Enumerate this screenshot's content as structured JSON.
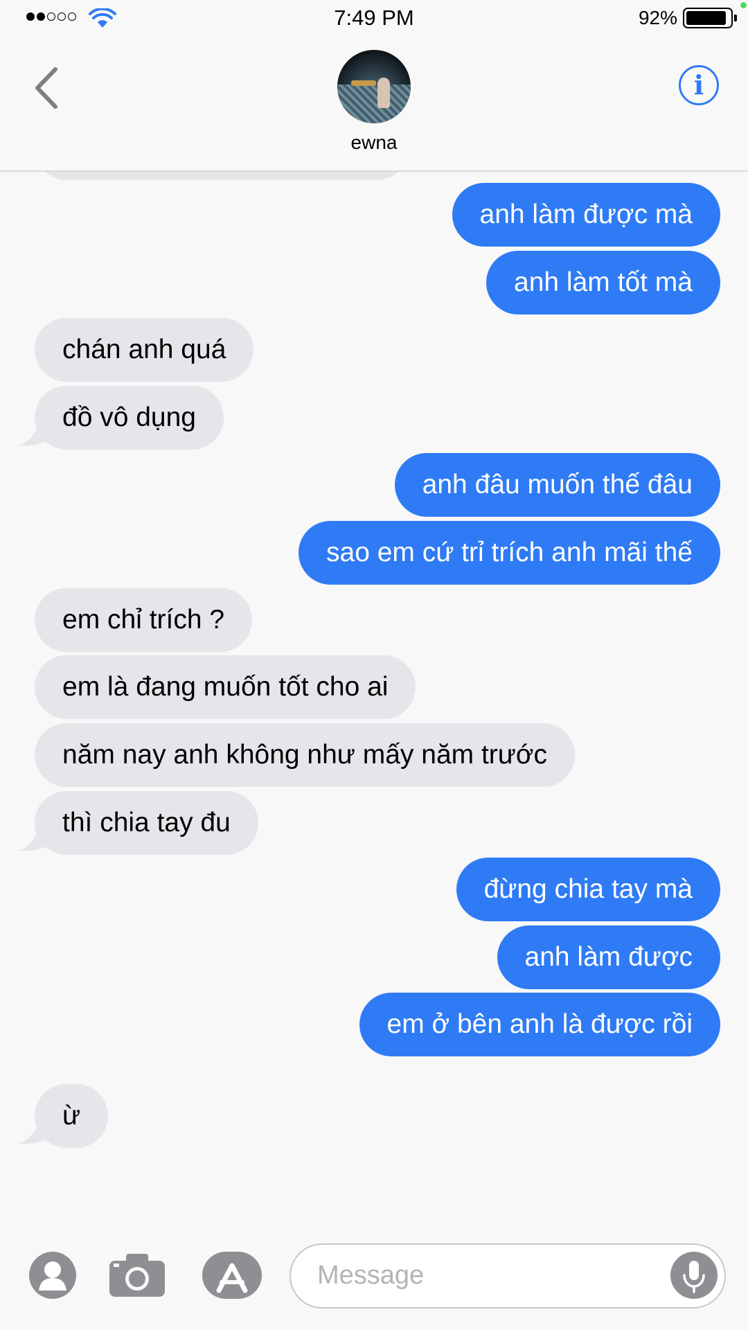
{
  "status_bar": {
    "time": "7:49 PM",
    "battery_percent": "92%",
    "signal_bars_filled": 2,
    "signal_bars_total": 5
  },
  "header": {
    "contact_name": "ewna",
    "back_icon": "chevron-left-icon",
    "info_icon": "info-icon"
  },
  "messages": [
    {
      "from": "me",
      "text": "anh làm được mà"
    },
    {
      "from": "me",
      "text": "anh làm tốt mà"
    },
    {
      "from": "them",
      "text": "chán anh quá"
    },
    {
      "from": "them",
      "text": "đồ vô dụng"
    },
    {
      "from": "me",
      "text": "anh đâu muốn thế đâu"
    },
    {
      "from": "me",
      "text": "sao em cứ trỉ trích anh mãi thế"
    },
    {
      "from": "them",
      "text": "em chỉ trích ?"
    },
    {
      "from": "them",
      "text": "em là đang muốn tốt cho ai"
    },
    {
      "from": "them",
      "text": "năm nay anh không như mấy năm trước"
    },
    {
      "from": "them",
      "text": "thì chia tay đu"
    },
    {
      "from": "me",
      "text": "đừng chia tay mà"
    },
    {
      "from": "me",
      "text": "anh làm được"
    },
    {
      "from": "me",
      "text": "em ở bên anh là được rồi"
    },
    {
      "from": "them",
      "text": "ừ"
    }
  ],
  "input": {
    "placeholder": "Message",
    "value": ""
  },
  "colors": {
    "outgoing": "#2f7bf5",
    "incoming": "#e5e5ea",
    "accent": "#2f7bf5"
  }
}
